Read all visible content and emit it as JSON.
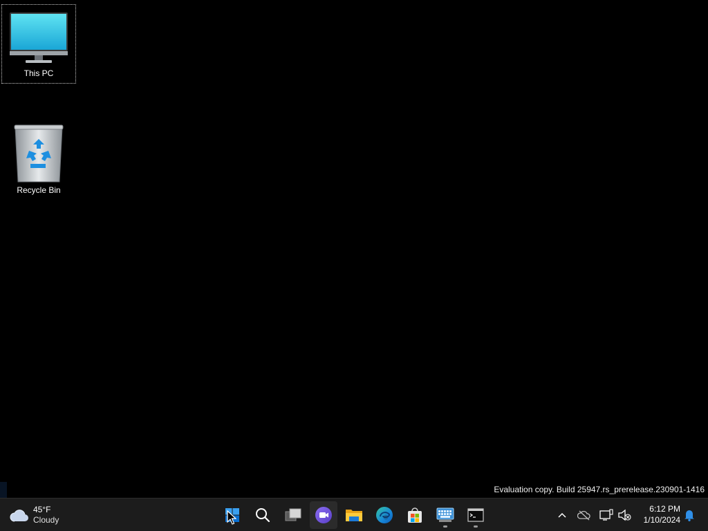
{
  "desktop": {
    "icons": [
      {
        "label": "This PC",
        "icon": "monitor-icon",
        "selected": true
      },
      {
        "label": "Recycle Bin",
        "icon": "recycle-bin-icon",
        "selected": false
      }
    ],
    "watermark": "Evaluation copy. Build 25947.rs_prerelease.230901-1416"
  },
  "taskbar": {
    "weather": {
      "temperature": "45°F",
      "condition": "Cloudy",
      "icon": "cloud-icon"
    },
    "apps": [
      {
        "name": "Start",
        "icon": "windows-start-icon",
        "active": false,
        "running": false
      },
      {
        "name": "Search",
        "icon": "search-icon",
        "active": false,
        "running": false
      },
      {
        "name": "Task View",
        "icon": "task-view-icon",
        "active": false,
        "running": false
      },
      {
        "name": "Meet",
        "icon": "meet-icon",
        "active": true,
        "running": false
      },
      {
        "name": "File Explorer",
        "icon": "folder-icon",
        "active": false,
        "running": false
      },
      {
        "name": "Microsoft Edge",
        "icon": "edge-icon",
        "active": false,
        "running": false
      },
      {
        "name": "Microsoft Store",
        "icon": "store-icon",
        "active": false,
        "running": false
      },
      {
        "name": "On-Screen Keyboard",
        "icon": "keyboard-icon",
        "active": false,
        "running": true
      },
      {
        "name": "Command Prompt",
        "icon": "terminal-icon",
        "active": false,
        "running": true
      }
    ],
    "tray": {
      "chevron_icon": "chevron-up-icon",
      "icons": [
        "onedrive-offline-icon",
        "network-icon",
        "volume-muted-icon"
      ],
      "time": "6:12 PM",
      "date": "1/10/2024",
      "notification_icon": "bell-icon"
    }
  },
  "colors": {
    "desktop_bg": "#000000",
    "taskbar_bg": "#1c1c1c",
    "accent": "#0078d4"
  }
}
